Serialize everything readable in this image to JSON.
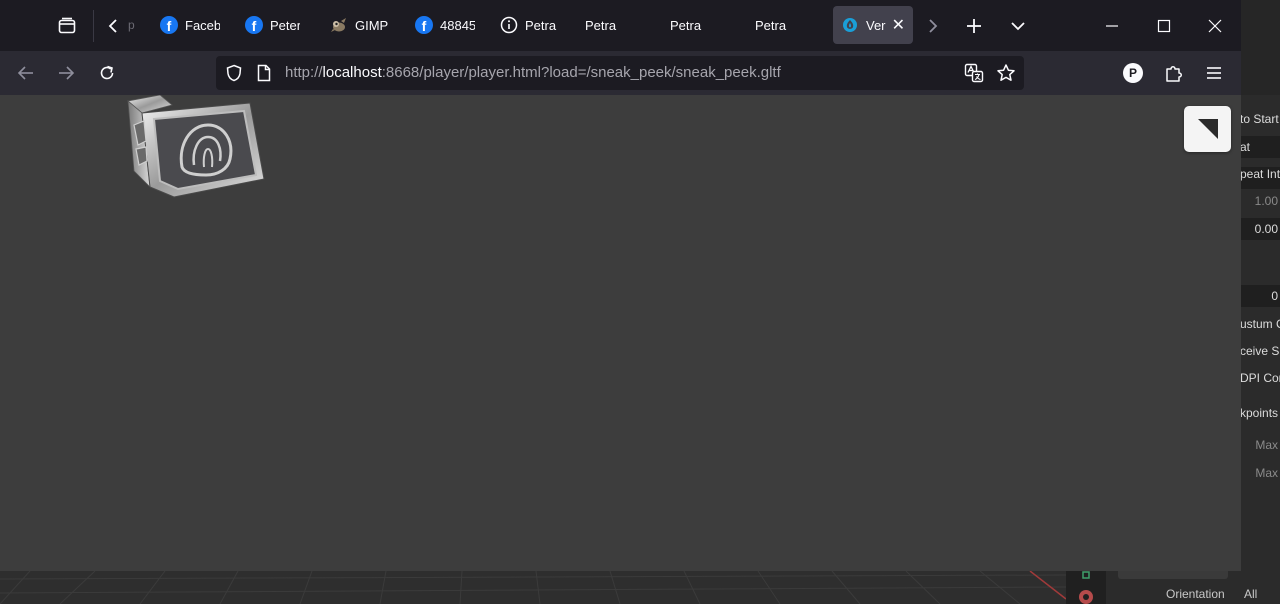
{
  "background_app": {
    "right_panel": [
      {
        "text": "to Start",
        "style": "label"
      },
      {
        "text": "at",
        "style": "field"
      },
      {
        "text": "peat Int",
        "style": "label"
      },
      {
        "text": "1.00",
        "style": "num-dim"
      },
      {
        "text": "0.00",
        "style": "num-field"
      },
      {
        "text": "",
        "style": "spacer"
      },
      {
        "text": "0",
        "style": "num-field"
      },
      {
        "text": "ustum C",
        "style": "label"
      },
      {
        "text": "ceive Sh",
        "style": "label"
      },
      {
        "text": "DPI Con",
        "style": "label"
      },
      {
        "text": "kpoints",
        "style": "label"
      },
      {
        "text": "Max",
        "style": "num-dim"
      },
      {
        "text": "Max",
        "style": "num-dim"
      }
    ],
    "orientation_label": "Orientation",
    "orientation_value": "All"
  },
  "tabs": {
    "faded_left_text": "p",
    "items": [
      {
        "label": "Faceb",
        "icon": "facebook-icon",
        "x": 0
      },
      {
        "label": "Peter (",
        "icon": "facebook-icon",
        "x": 0
      },
      {
        "label": "GIMP",
        "icon": "gimp-icon",
        "x": 0
      },
      {
        "label": "48845",
        "icon": "facebook-icon",
        "x": 0
      },
      {
        "label": "Petra",
        "icon": "info-icon",
        "x": 0
      },
      {
        "label": "Petra",
        "icon": "none",
        "x": 0
      },
      {
        "label": "Petra",
        "icon": "none",
        "x": 0
      },
      {
        "label": "Petra",
        "icon": "none",
        "x": 0
      }
    ],
    "active": {
      "label": "Ver",
      "icon": "verge-icon"
    },
    "close_glyph": "✕",
    "new_tab_glyph": "+"
  },
  "navbar": {
    "url_prefix": "http://",
    "url_host": "localhost",
    "url_rest": ":8668/player/player.html?load=/sneak_peek/sneak_peek.gltf",
    "profile_initial": "P"
  },
  "colors": {
    "facebook": "#1877f2",
    "page_background": "#3d3d3d",
    "active_tab": "#42414d"
  }
}
